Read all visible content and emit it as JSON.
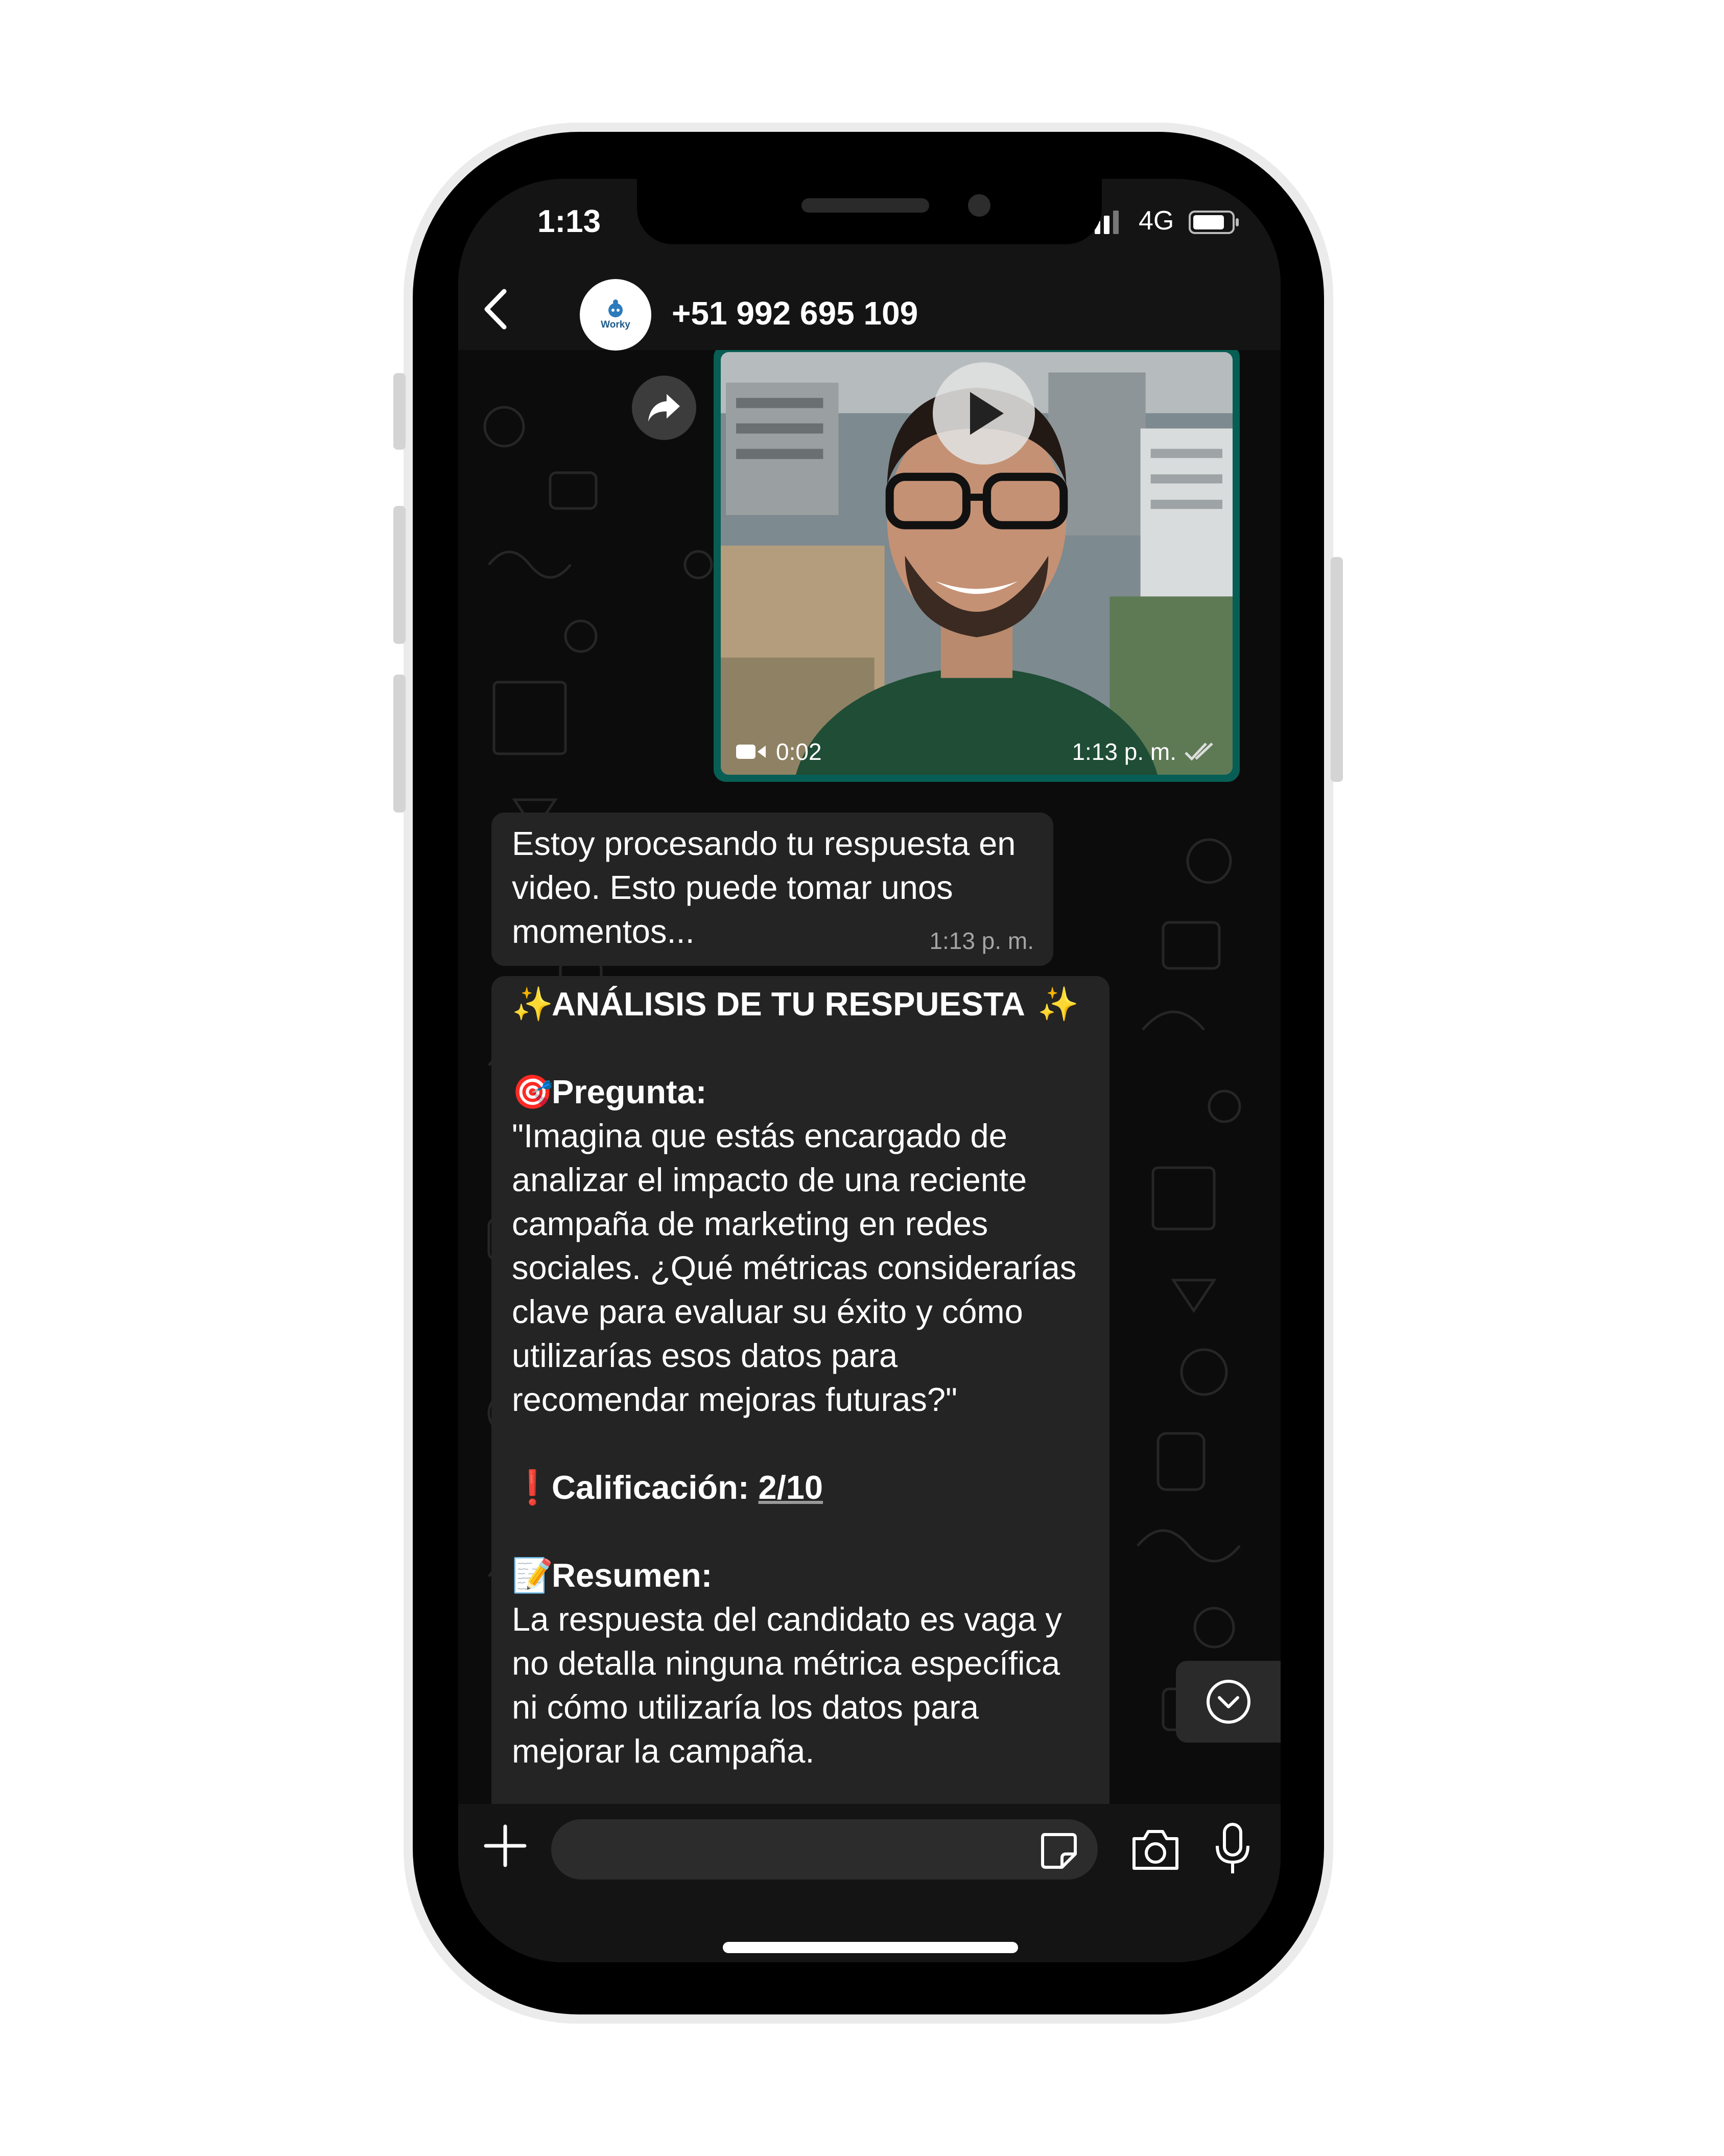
{
  "status_bar": {
    "time": "1:13",
    "network": "4G"
  },
  "header": {
    "contact": "+51 992 695 109",
    "avatar_text": "Worky"
  },
  "video_message": {
    "duration": "0:02",
    "time": "1:13 p. m."
  },
  "processing_message": {
    "lines": [
      "Estoy procesando tu respuesta en",
      "video. Esto puede tomar unos",
      "momentos..."
    ],
    "time": "1:13 p. m."
  },
  "analysis_message": {
    "title": "ANÁLISIS DE TU RESPUESTA",
    "title_emoji": "✨",
    "question_emoji": "🎯",
    "question_label": "Pregunta:",
    "question_lines": [
      "\"Imagina que estás encargado de",
      "analizar el impacto de una reciente",
      "campaña de marketing en redes",
      "sociales. ¿Qué métricas considerarías",
      "clave para evaluar su éxito y cómo",
      "utilizarías esos datos para",
      "recomendar mejoras futuras?\""
    ],
    "score_emoji": "❗",
    "score_label": "Calificación:",
    "score_value": "2/10",
    "summary_emoji": "📝",
    "summary_label": "Resumen:",
    "summary_lines": [
      "La respuesta del candidato es vaga y",
      "no detalla ninguna métrica específica",
      "ni cómo utilizaría los datos para",
      "mejorar la campaña."
    ]
  },
  "input": {
    "placeholder": "",
    "value": ""
  },
  "colors": {
    "bubble": "#242424",
    "video_border": "#075e54",
    "bar": "#141414",
    "text": "#ffffff",
    "timestamp": "#a5a5a5"
  },
  "icons": [
    "back-icon",
    "forward-icon",
    "play-icon",
    "video-camera-icon",
    "read-receipt-icon",
    "scroll-down-icon",
    "plus-icon",
    "sticker-icon",
    "camera-icon",
    "microphone-icon"
  ]
}
